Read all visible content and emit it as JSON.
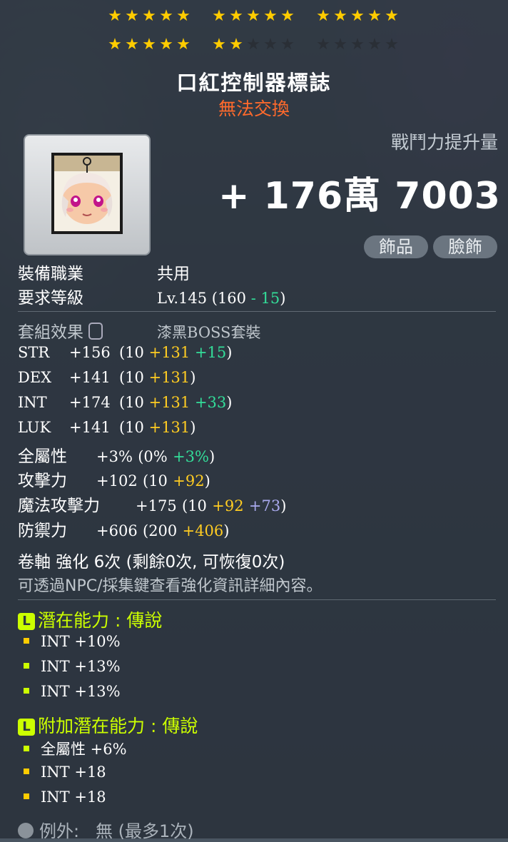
{
  "stars": {
    "row1": [
      5,
      5,
      5
    ],
    "row2": [
      5,
      2,
      0
    ],
    "per_group": 5
  },
  "item": {
    "name": "口紅控制器標誌",
    "trade_status": "無法交換",
    "icon": "lipstick-controller-emblem-icon"
  },
  "combat_power": {
    "label": "戰鬥力提升量",
    "value": "+ 176萬 7003"
  },
  "tags": [
    "飾品",
    "臉飾"
  ],
  "requirements": {
    "job_label": "裝備職業",
    "job_value": "共用",
    "level_label": "要求等級",
    "level_value": "Lv.145 (160 ",
    "level_reduce": "- 15",
    "level_close": ")"
  },
  "set": {
    "label": "套組效果",
    "value": "漆黑BOSS套裝"
  },
  "stats": [
    {
      "name": "STR",
      "total": "+156",
      "base": "(10",
      "bonus": "+131",
      "extra": "+15",
      "extra_color": "g",
      "close": ")"
    },
    {
      "name": "DEX",
      "total": "+141",
      "base": "(10",
      "bonus": "+131",
      "extra": "",
      "extra_color": "g",
      "close": ")"
    },
    {
      "name": "INT",
      "total": "+174",
      "base": "(10",
      "bonus": "+131",
      "extra": "+33",
      "extra_color": "g",
      "close": ")"
    },
    {
      "name": "LUK",
      "total": "+141",
      "base": "(10",
      "bonus": "+131",
      "extra": "",
      "extra_color": "g",
      "close": ")"
    }
  ],
  "all_stat": {
    "label": "全屬性",
    "total": "+3%",
    "base": "(0%",
    "extra": "+3%",
    "close": ")"
  },
  "attack": {
    "label": "攻擊力",
    "total": "+102",
    "base": "(10",
    "bonus": "+92",
    "close": ")"
  },
  "magic_attack": {
    "label": "魔法攻擊力",
    "total": "+175",
    "base": "(10",
    "bonus": "+92",
    "extra": "+73",
    "close": ")"
  },
  "defense": {
    "label": "防禦力",
    "total": "+606",
    "base": "(200",
    "bonus": "+406",
    "close": ")"
  },
  "scroll": {
    "text": "卷軸 強化 6次 (剩餘0次, 可恢復0次)",
    "hint": "可透過NPC/採集鍵查看強化資訊詳細內容。"
  },
  "potential": {
    "title": "潛在能力 : 傳說",
    "badge": "L",
    "lines": [
      {
        "text": "INT +10%",
        "color": "#ffcc00"
      },
      {
        "text": "INT +13%",
        "color": "#ccff00"
      },
      {
        "text": "INT +13%",
        "color": "#ccff00"
      }
    ]
  },
  "additional_potential": {
    "title": "附加潛在能力 : 傳說",
    "badge": "L",
    "lines": [
      {
        "text": "全屬性 +6%",
        "color": "#ccff00"
      },
      {
        "text": "INT +18",
        "color": "#ffcc00"
      },
      {
        "text": "INT +18",
        "color": "#ffcc00"
      }
    ]
  },
  "exceptional": {
    "label": "例外:",
    "value": "無 (最多1次)"
  },
  "colors": {
    "gold": "#ffcc00",
    "legendary": "#ccff00",
    "untradable": "#ff6a2c",
    "green": "#33dd99",
    "purple": "#aaaaee"
  }
}
